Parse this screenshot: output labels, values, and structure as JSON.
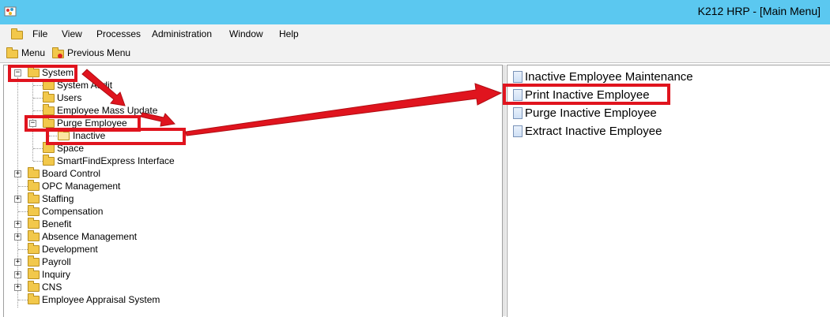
{
  "window": {
    "title": "K212 HRP - [Main Menu]"
  },
  "menubar": [
    "File",
    "View",
    "Processes",
    "Administration",
    "Window",
    "Help"
  ],
  "toolbar": {
    "menu": "Menu",
    "previous_menu": "Previous Menu"
  },
  "tree": {
    "system": "System",
    "system_children": [
      "System Audit",
      "Users",
      "Employee Mass Update"
    ],
    "purge_employee": "Purge Employee",
    "inactive": "Inactive",
    "after_purge": [
      "Space",
      "SmartFindExpress Interface"
    ],
    "top_level": [
      {
        "label": "Board Control",
        "expandable": true
      },
      {
        "label": "OPC Management",
        "expandable": false
      },
      {
        "label": "Staffing",
        "expandable": true
      },
      {
        "label": "Compensation",
        "expandable": false
      },
      {
        "label": "Benefit",
        "expandable": true
      },
      {
        "label": "Absence Management",
        "expandable": true
      },
      {
        "label": "Development",
        "expandable": false
      },
      {
        "label": "Payroll",
        "expandable": true
      },
      {
        "label": "Inquiry",
        "expandable": true
      },
      {
        "label": "CNS",
        "expandable": true
      },
      {
        "label": "Employee Appraisal System",
        "expandable": false
      }
    ]
  },
  "items": [
    "Inactive Employee Maintenance",
    "Print Inactive Employee",
    "Purge Inactive Employee",
    "Extract Inactive Employee"
  ],
  "colors": {
    "titlebar": "#5bc8f0",
    "highlight": "#e0141e",
    "folder": "#f2c84b"
  }
}
